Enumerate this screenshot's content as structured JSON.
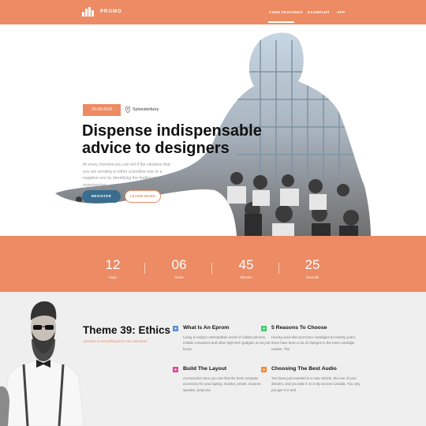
{
  "header": {
    "brand": "PROMO",
    "nav": [
      {
        "label": "CORE FEATURES",
        "active": true
      },
      {
        "label": "EXAMPLES",
        "active": false
      },
      {
        "label": "APP",
        "active": false
      }
    ]
  },
  "hero": {
    "date": "20-08-2018",
    "location": "Sylvesterbury",
    "headline_line1": "Dispense indispensable",
    "headline_line2": "advice to designers",
    "lead": "At every moment you can tell if the vibration that you are sending is either a positive one or a negative one by identifying the feeling you are experiencing.",
    "register_label": "REGISTER",
    "learn_label": "LEARN MORE"
  },
  "countdown": [
    {
      "value": "12",
      "label": "Days"
    },
    {
      "value": "06",
      "label": "Hours"
    },
    {
      "value": "45",
      "label": "Minutes"
    },
    {
      "value": "25",
      "label": "Seconds"
    }
  ],
  "theme": {
    "title": "Theme 39: Ethics",
    "subtitle": "present in everything from our identities"
  },
  "features": [
    {
      "icon": "square-blue-icon",
      "color": "#5a8fd8",
      "title": "What Is An Eprom",
      "text": "Living in today's metropolitan world of cellular phones, mobile computers and other high-tech gadgets is not just hectic"
    },
    {
      "icon": "square-green-icon",
      "color": "#3ecb6b",
      "title": "5 Reasons To Choose",
      "text": "Having used discount toner cartridges for twenty years, there have been a lot of changes in the toner cartridge market. The"
    },
    {
      "icon": "square-pink-icon",
      "color": "#e0479a",
      "title": "Build The Layout",
      "text": "Accessories Here you can find the best computer accessory for your laptop, monitor, printer, scanner, speaker, projector,"
    },
    {
      "icon": "square-orange-icon",
      "color": "#f28a2e",
      "title": "Choosing The Best Audio",
      "text": "You have just invested in a new vehicle, the one of your dreams, and you take it on a trip across Canada. You only put gas in it and"
    }
  ],
  "colors": {
    "accent": "#ec8b64",
    "primary_button": "#3a6d8f"
  }
}
